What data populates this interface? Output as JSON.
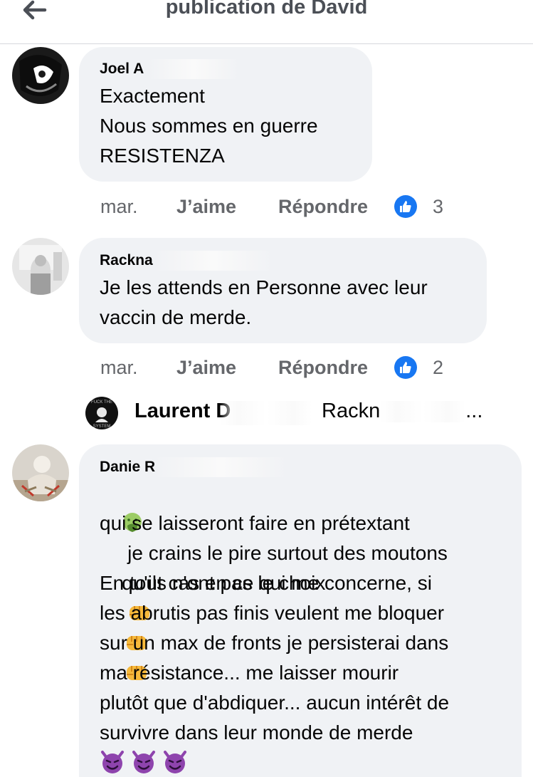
{
  "header": {
    "title": "publication de David",
    "back_icon": "arrow-left-icon"
  },
  "comments": [
    {
      "author": "Joel A",
      "lines": [
        "Exactement",
        "Nous sommes en guerre",
        "RESISTENZA"
      ],
      "time": "mar.",
      "like_label": "J’aime",
      "reply_label": "Répondre",
      "reaction_icon": "like-icon",
      "reaction_count": "3"
    },
    {
      "author": "Rackna",
      "lines": [
        "Je les attends en Personne avec leur",
        "vaccin de merde."
      ],
      "time": "mar.",
      "like_label": "J’aime",
      "reply_label": "Répondre",
      "reaction_icon": "like-icon",
      "reaction_count": "2"
    },
    {
      "author": "Danie R",
      "lines": [
        "je crains le pire surtout des moutons",
        "qui se laisseront faire en prétextant",
        "qu'ils n'ont pas le choix",
        "En tout cas en ce qui me concerne, si",
        "les abrutis pas finis veulent me bloquer",
        "sur un max de fronts je persisterai dans",
        "ma résistance... me laisser mourir",
        "plutôt que d'abdiquer... aucun intérêt de",
        "survivre dans leur monde de merde"
      ],
      "emojis": [
        "nauseated-face-emoji",
        "oncoming-fist-emoji",
        "smiling-face-with-horns-emoji"
      ]
    }
  ],
  "reply_preview": {
    "avatar_text_top": "FUCK THE",
    "avatar_text_bottom": "SYSTEM",
    "author": "Laurent D",
    "snippet_start": "Rackn",
    "snippet_end": "..."
  },
  "colors": {
    "like_blue": "#1877f2",
    "bubble": "#f0f2f5",
    "secondary_text": "#65676b"
  }
}
